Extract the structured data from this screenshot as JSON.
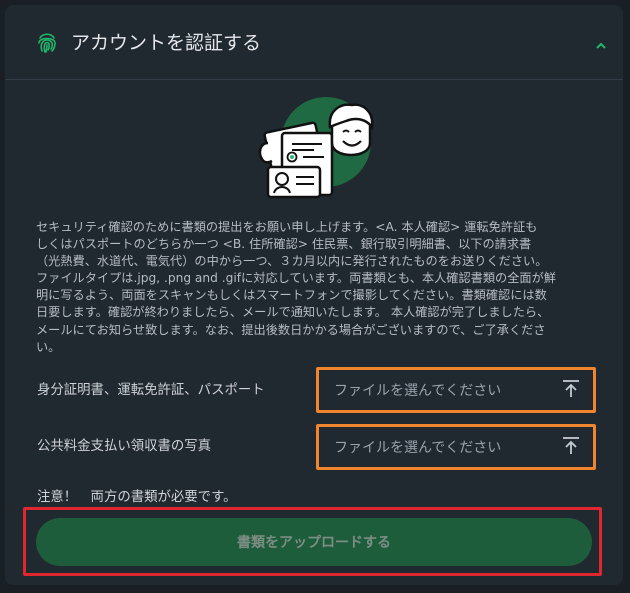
{
  "section": {
    "title": "アカウントを認証する",
    "fingerprint_icon": "fingerprint-icon",
    "collapse_icon": "chevron-up-icon"
  },
  "hero": {
    "icon": "id-document-illustration"
  },
  "description": {
    "lines": [
      "セキュリティ確認のために書類の提出をお願い申し上げます。<A. 本人確認> 運転免許証も",
      "しくはパスポートのどちらか一つ <B. 住所確認> 住民票、銀行取引明細書、以下の請求書",
      "（光熱費、水道代、電気代）の中から一つ、３カ月以内に発行されたものをお送りください。",
      "ファイルタイプは.jpg, .png and .gifに対応しています。両書類とも、本人確認書類の全面が鮮",
      "明に写るよう、両面をスキャンもしくはスマートフォンで撮影してください。書類確認には数",
      "日要します。確認が終わりましたら、メールで通知いたします。 本人確認が完了しましたら、",
      "メールにてお知らせ致します。なお、提出後数日かかる場合がございますので、ご了承くださ",
      "い。"
    ]
  },
  "fields": [
    {
      "label": "身分証明書、運転免許証、パスポート",
      "placeholder": "ファイルを選んでください",
      "icon": "upload-icon"
    },
    {
      "label": "公共料金支払い領収書の写真",
      "placeholder": "ファイルを選んでください",
      "icon": "upload-icon"
    }
  ],
  "note": "注意！　両方の書類が必要です。",
  "submit": {
    "label": "書類をアップロードする"
  },
  "colors": {
    "accent_green": "#1e5d3c",
    "highlight_orange": "#f0852d",
    "highlight_red": "#e0262e"
  }
}
